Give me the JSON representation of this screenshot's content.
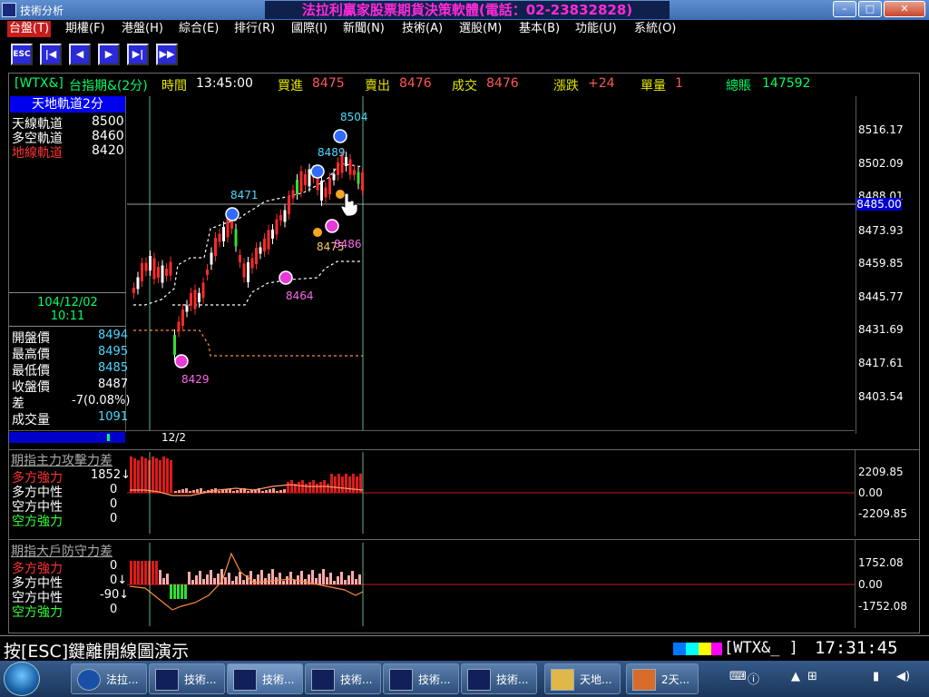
{
  "window": {
    "app_title": "技術分析",
    "brand_title": "法拉利贏家股票期貨決策軟體(電話：02-23832828)",
    "buttons": {
      "min": "–",
      "max": "□",
      "close": "✕"
    }
  },
  "menu": [
    {
      "label": "台盤(T)"
    },
    {
      "label": "期權(F)"
    },
    {
      "label": "港盤(H)"
    },
    {
      "label": "綜合(E)"
    },
    {
      "label": "排行(R)"
    },
    {
      "label": "國際(I)"
    },
    {
      "label": "新聞(N)"
    },
    {
      "label": "技術(A)"
    },
    {
      "label": "選股(M)"
    },
    {
      "label": "基本(B)"
    },
    {
      "label": "功能(U)"
    },
    {
      "label": "系統(O)"
    }
  ],
  "toolbar": [
    "ESC",
    "|◀",
    "◀",
    "▶",
    "▶|",
    "▶▶"
  ],
  "quote": {
    "symbol": "[WTX&]",
    "name": "台指期&(2分)",
    "time_label": "時間",
    "time": "13:45:00",
    "bid_label": "買進",
    "bid": "8475",
    "ask_label": "賣出",
    "ask": "8476",
    "last_label": "成交",
    "last": "8476",
    "change_label": "漲跌",
    "change": "+24",
    "vol_label": "單量",
    "vol": "1",
    "total_label": "總賬",
    "total": "147592"
  },
  "panel": {
    "title": "天地軌道2分",
    "tracks": [
      {
        "label": "天線軌道",
        "value": "8500",
        "color": "#ffffff"
      },
      {
        "label": "多空軌道",
        "value": "8460",
        "color": "#ffffff"
      },
      {
        "label": "地線軌道",
        "value": "8420",
        "color": "#ff3333"
      }
    ],
    "date": "104/12/02",
    "time": "10:11",
    "stats": [
      {
        "label": "開盤價",
        "value": "8494"
      },
      {
        "label": "最高價",
        "value": "8495"
      },
      {
        "label": "最低價",
        "value": "8485"
      },
      {
        "label": "收盤價",
        "value": "8487"
      },
      {
        "label": "差",
        "value": "-7(0.08%)"
      },
      {
        "label": "成交量",
        "value": "1091"
      }
    ]
  },
  "price_axis": {
    "ticks": [
      "8516.17",
      "8502.09",
      "8488.01",
      "8473.93",
      "8459.85",
      "8445.77",
      "8431.69",
      "8417.61",
      "8403.54"
    ],
    "current": "8485.00"
  },
  "time_axis": {
    "label": "12/2"
  },
  "markers": [
    {
      "label": "8504",
      "type": "sell"
    },
    {
      "label": "8489",
      "type": "sell"
    },
    {
      "label": "8471",
      "type": "sell"
    },
    {
      "label": "8464",
      "type": "buy"
    },
    {
      "label": "8429",
      "type": "buy"
    },
    {
      "label": "8475",
      "type": "dot"
    },
    {
      "label": "8486",
      "type": "buy"
    }
  ],
  "sub1": {
    "title": "期指主力攻擊力差",
    "rows": [
      {
        "label": "多方強力",
        "value": "1852↓",
        "color": "#ff3333"
      },
      {
        "label": "多方中性",
        "value": "0",
        "color": "#ffffff"
      },
      {
        "label": "空方中性",
        "value": "0",
        "color": "#ffffff"
      },
      {
        "label": "空方強力",
        "value": "0",
        "color": "#33ff33"
      }
    ],
    "ticks": [
      "2209.85",
      "0.00",
      "-2209.85"
    ]
  },
  "sub2": {
    "title": "期指大戶防守力差",
    "rows": [
      {
        "label": "多方強力",
        "value": "0",
        "color": "#ff3333"
      },
      {
        "label": "多方中性",
        "value": "0↓",
        "color": "#ffffff"
      },
      {
        "label": "空方中性",
        "value": "-90↓",
        "color": "#ffffff"
      },
      {
        "label": "空方強力",
        "value": "0",
        "color": "#33ff33"
      }
    ],
    "ticks": [
      "1752.08",
      "0.00",
      "-1752.08"
    ]
  },
  "status": {
    "hint": "按[ESC]鍵離開線圖演示",
    "code": "[WTX&_ ]",
    "clock": "17:31:45"
  },
  "taskbar": {
    "items": [
      {
        "label": "法拉..."
      },
      {
        "label": "技術..."
      },
      {
        "label": "技術..."
      },
      {
        "label": "技術..."
      },
      {
        "label": "技術..."
      },
      {
        "label": "技術..."
      },
      {
        "label": "天地..."
      },
      {
        "label": "2天..."
      }
    ]
  }
}
